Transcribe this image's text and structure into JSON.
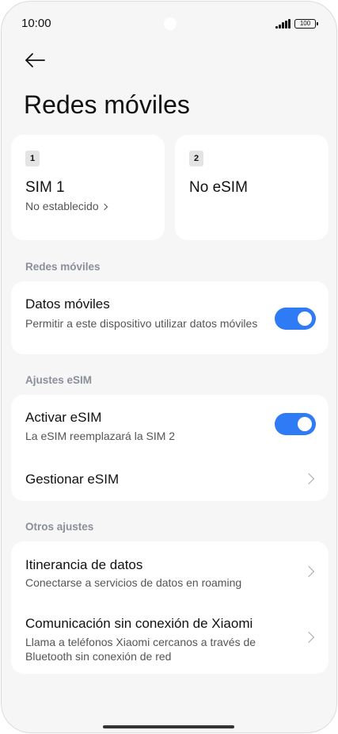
{
  "status_bar": {
    "time": "10:00",
    "battery": "100",
    "icons": [
      "signal-icon",
      "battery-icon"
    ]
  },
  "header": {
    "back_icon": "arrow-left-icon",
    "title": "Redes móviles"
  },
  "sim_cards": [
    {
      "badge": "1",
      "name": "SIM 1",
      "status": "No establecido"
    },
    {
      "badge": "2",
      "name": "No eSIM"
    }
  ],
  "sections": {
    "mobile_networks": {
      "label": "Redes móviles",
      "mobile_data": {
        "title": "Datos móviles",
        "subtitle": "Permitir a este dispositivo utilizar datos móviles",
        "enabled": true
      }
    },
    "esim": {
      "label": "Ajustes eSIM",
      "activate": {
        "title": "Activar eSIM",
        "subtitle": "La eSIM reemplazará la SIM 2",
        "enabled": true
      },
      "manage": {
        "title": "Gestionar eSIM"
      }
    },
    "other": {
      "label": "Otros ajustes",
      "roaming": {
        "title": "Itinerancia de datos",
        "subtitle": "Conectarse a servicios de datos en roaming"
      },
      "offline_comm": {
        "title": "Comunicación sin conexión de Xiaomi",
        "subtitle": "Llama a teléfonos Xiaomi cercanos a través de Bluetooth sin conexión de red"
      }
    }
  },
  "colors": {
    "accent": "#2f7bf6",
    "background": "#f6f6f6",
    "card": "#ffffff",
    "section_label": "#8a8f9a"
  }
}
